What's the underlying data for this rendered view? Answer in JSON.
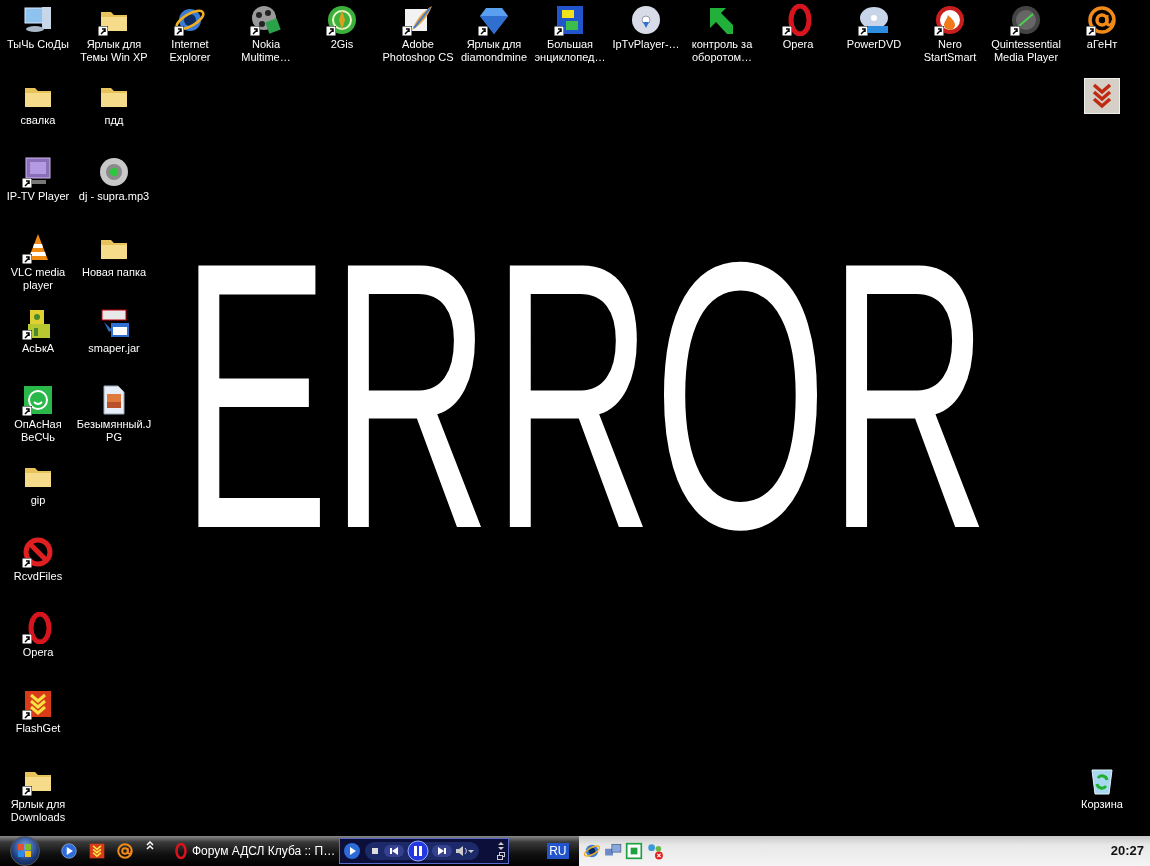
{
  "wallpaper": {
    "text": "ERROR"
  },
  "top_row": [
    {
      "label": "ТыЧь СюДы",
      "kind": "computer",
      "shortcut": false
    },
    {
      "label": "Ярлык для\nТемы Win XP",
      "kind": "folder",
      "shortcut": true
    },
    {
      "label": "Internet\nExplorer",
      "kind": "globe",
      "shortcut": true
    },
    {
      "label": "Nokia\nMultime…",
      "kind": "reel",
      "shortcut": true
    },
    {
      "label": "2Gis",
      "kind": "compass",
      "shortcut": true
    },
    {
      "label": "Adobe\nPhotoshop CS",
      "kind": "feather",
      "shortcut": true
    },
    {
      "label": "Ярлык для\ndiamondmine",
      "kind": "diamond",
      "shortcut": true
    },
    {
      "label": "Большая\nэнциклопед…",
      "kind": "book",
      "shortcut": true
    },
    {
      "label": "IpTvPlayer-…",
      "kind": "disc",
      "shortcut": false
    },
    {
      "label": "контроль за\nоборотом…",
      "kind": "arrow",
      "shortcut": false
    },
    {
      "label": "Opera",
      "kind": "opera",
      "shortcut": true
    },
    {
      "label": "PowerDVD",
      "kind": "dvd",
      "shortcut": true
    },
    {
      "label": "Nero\nStartSmart",
      "kind": "flame",
      "shortcut": true
    },
    {
      "label": "Quintessential\nMedia Player",
      "kind": "player",
      "shortcut": true
    },
    {
      "label": "аГеНт",
      "kind": "at",
      "shortcut": true
    }
  ],
  "column_1": [
    {
      "label": "свалка",
      "kind": "folder",
      "shortcut": false
    },
    {
      "label": "IP-TV Player",
      "kind": "monitor",
      "shortcut": true
    },
    {
      "label": "VLC media\nplayer",
      "kind": "cone",
      "shortcut": true
    },
    {
      "label": "АсЬкА",
      "kind": "robot",
      "shortcut": true
    },
    {
      "label": "ОпАсНая\nВеСЧь",
      "kind": "smiley",
      "shortcut": true
    },
    {
      "label": "gip",
      "kind": "folder",
      "shortcut": false
    },
    {
      "label": "RcvdFiles",
      "kind": "noentry",
      "shortcut": true
    },
    {
      "label": "Opera",
      "kind": "opera",
      "shortcut": true
    },
    {
      "label": "FlashGet",
      "kind": "chevrons",
      "shortcut": true
    },
    {
      "label": "Ярлык для\nDownloads",
      "kind": "folder",
      "shortcut": true
    }
  ],
  "column_2": [
    {
      "label": "пдд",
      "kind": "folder",
      "shortcut": false
    },
    {
      "label": "dj - supra.mp3",
      "kind": "speaker",
      "shortcut": false
    },
    {
      "label": "Новая папка",
      "kind": "folder",
      "shortcut": false
    },
    {
      "label": "smaper.jar",
      "kind": "app",
      "shortcut": false
    },
    {
      "label": "Безымянный.J\nPG",
      "kind": "image",
      "shortcut": false
    }
  ],
  "bottom_right": [
    {
      "label": "Корзина",
      "kind": "recycle",
      "shortcut": false
    }
  ],
  "taskbar": {
    "quick_launch": [
      {
        "kind": "play"
      },
      {
        "kind": "chevrons"
      },
      {
        "kind": "at"
      }
    ],
    "tasks": [
      {
        "label": "Форум АДСЛ Клуба :: П…",
        "kind": "opera",
        "selected": false
      }
    ],
    "language": "RU",
    "tray": [
      {
        "kind": "globe"
      },
      {
        "kind": "network"
      },
      {
        "kind": "green"
      },
      {
        "kind": "neterror"
      }
    ],
    "clock": "20:27"
  }
}
